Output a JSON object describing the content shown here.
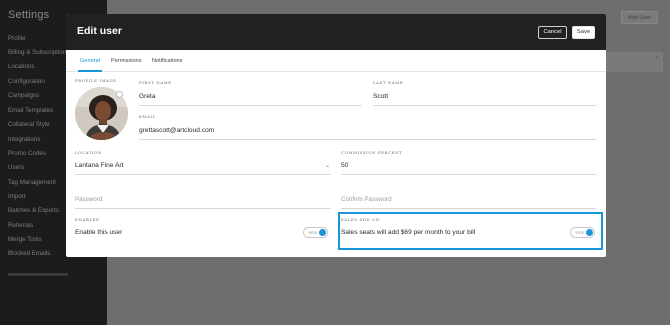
{
  "sidebar": {
    "title": "Settings",
    "items": [
      {
        "label": "Profile"
      },
      {
        "label": "Billing & Subscription"
      },
      {
        "label": "Locations"
      },
      {
        "label": "Configuration"
      },
      {
        "label": "Campaigns"
      },
      {
        "label": "Email Templates"
      },
      {
        "label": "Collateral Style"
      },
      {
        "label": "Integrations"
      },
      {
        "label": "Promo Codes"
      },
      {
        "label": "Users"
      },
      {
        "label": "Tag Management"
      },
      {
        "label": "Import"
      },
      {
        "label": "Batches & Exports"
      },
      {
        "label": "Referrals"
      },
      {
        "label": "Merge Tools"
      },
      {
        "label": "Blocked Emails"
      }
    ]
  },
  "background": {
    "add_user_label": "Add User"
  },
  "modal": {
    "title": "Edit user",
    "cancel_label": "Cancel",
    "save_label": "Save",
    "tabs": [
      {
        "label": "General",
        "active": true
      },
      {
        "label": "Permissions",
        "active": false
      },
      {
        "label": "Notifications",
        "active": false
      }
    ],
    "profile_image_label": "PROFILE IMAGE",
    "first_name": {
      "label": "FIRST NAME",
      "value": "Greta"
    },
    "last_name": {
      "label": "LAST NAME",
      "value": "Scott"
    },
    "email": {
      "label": "EMAIL",
      "value": "grettascott@artcloud.com"
    },
    "location": {
      "label": "LOCATION",
      "value": "Lantana Fine Art"
    },
    "commission": {
      "label": "COMMISSION PERCENT",
      "value": "50"
    },
    "password": {
      "placeholder": "Password"
    },
    "confirm_password": {
      "placeholder": "Confirm Password"
    },
    "enabled": {
      "label": "ENABLED",
      "text": "Enable this user",
      "toggle": "YES"
    },
    "sales_add_on": {
      "label": "SALES ADD ON",
      "text": "Sales seats will add $69 per month to your bill",
      "toggle": "YES"
    }
  },
  "colors": {
    "accent": "#1a95d6",
    "header": "#212121"
  }
}
